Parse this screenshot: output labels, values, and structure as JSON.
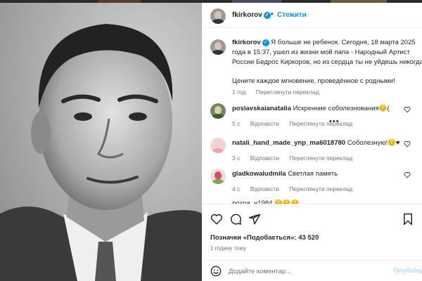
{
  "post": {
    "username": "fkirkorov",
    "follow_label": "Стежити",
    "separator": "•"
  },
  "caption": {
    "username": "fkirkorov",
    "line1": "Я больше не ребенок. Сегодня, 18 марта 2025",
    "line2": "года в 15:37, ушел из жизни мой папа - Народный Артист",
    "line3": "России Бедрос Киркоров, но из сердца ты не уйдешь никогда!",
    "line4": "Цените каждое мгновение, проведённое с родными!",
    "time": "1 год",
    "translate_label": "Переглянути переклад"
  },
  "comments": [
    {
      "username": "poslavskaianatalia",
      "text": "Искренние соболезнования😔(",
      "time": "5 с",
      "reply_label": "Відповісти",
      "translate_label": "Переглянути переклад",
      "more": "•••"
    },
    {
      "username": "natali_hand_made_ynp_ma6018780",
      "text": "Соболезную!😔♥",
      "time": "3 с",
      "reply_label": "Відповісти",
      "translate_label": "Переглянути переклад"
    },
    {
      "username": "gladkowaludmila",
      "text": "Светлая память",
      "time": "4 с",
      "reply_label": "Відповісти",
      "translate_label": "Переглянути переклад"
    }
  ],
  "partial_comment": "рохра_н1984 😔😔😔",
  "actions": {
    "likes_text": "Позначки «Подобається»: 43 520",
    "time_ago": "1 годину тому",
    "icons": [
      "heart-icon",
      "comment-icon",
      "share-icon",
      "bookmark-icon"
    ]
  },
  "add_comment": {
    "placeholder": "Додайте коментар...",
    "post_label": "Опублікувати"
  },
  "colors": {
    "accent": "#0095f6",
    "text": "#262626",
    "muted": "#737373",
    "disabled_post": "#b3dbff"
  }
}
